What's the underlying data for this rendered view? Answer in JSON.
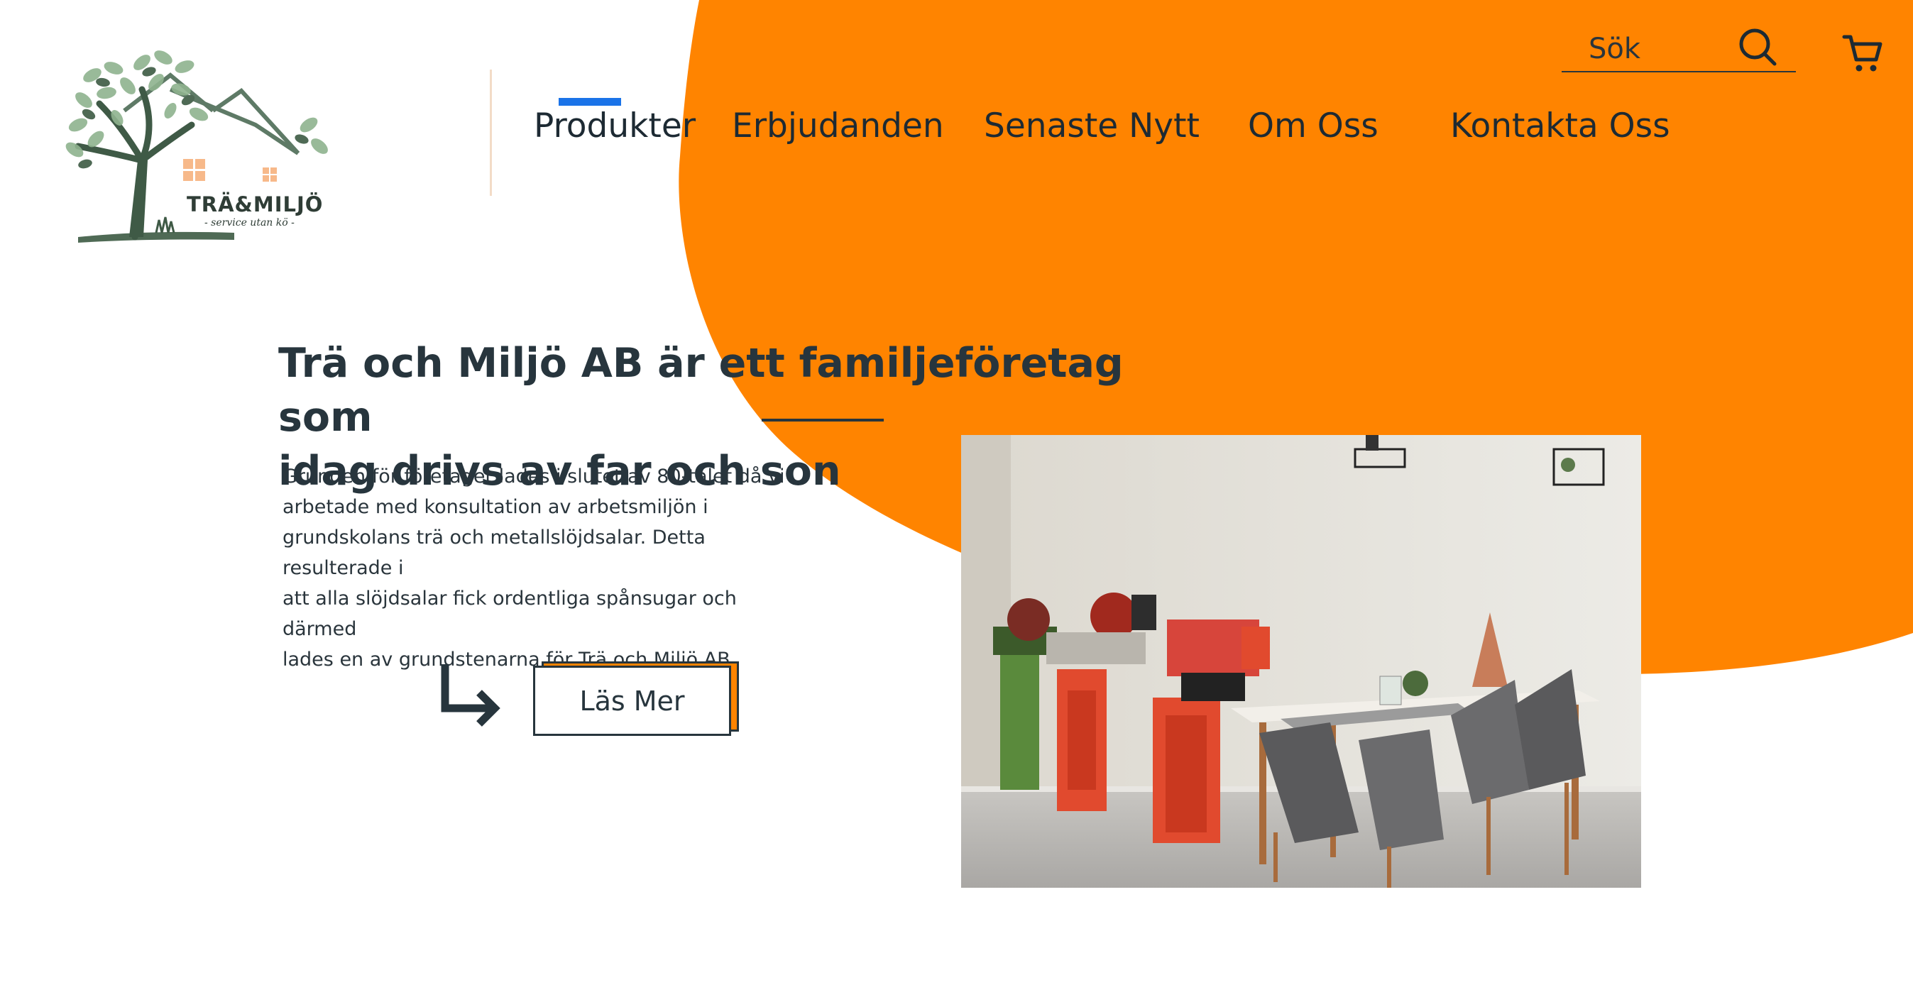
{
  "brand": {
    "name": "TRÄ&MILJÖ",
    "tagline": "- service utan kö -",
    "logo_icon": "tree-house-logo"
  },
  "nav": {
    "active_index": 0,
    "items": [
      {
        "label": "Produkter"
      },
      {
        "label": "Erbjudanden"
      },
      {
        "label": "Senaste Nytt"
      },
      {
        "label": "Om Oss"
      },
      {
        "label": "Kontakta Oss"
      }
    ]
  },
  "search": {
    "placeholder": "Sök",
    "icon": "search-icon"
  },
  "cart": {
    "icon": "cart-icon"
  },
  "hero": {
    "headline_line1": "Trä och Miljö AB är ett familjeföretag som",
    "headline_line2": "idag drivs av far och son",
    "body_lines": [
      "Grunden för företaget lades i slutet av 80-talet då vi",
      "arbetade med konsultation av arbetsmiljön i",
      "grundskolans trä och metallslöjdsalar. Detta resulterade i",
      "att alla slöjdsalar fick ordentliga spånsugar och därmed",
      "lades en av grundstenarna för Trä och Miljö AB."
    ],
    "cta_label": "Läs Mer",
    "cta_icon": "arrow-down-right-icon",
    "image_icon": "workshop-photo"
  },
  "colors": {
    "accent": "#ff8400",
    "active_nav": "#1a73e8",
    "text": "#27353d"
  }
}
